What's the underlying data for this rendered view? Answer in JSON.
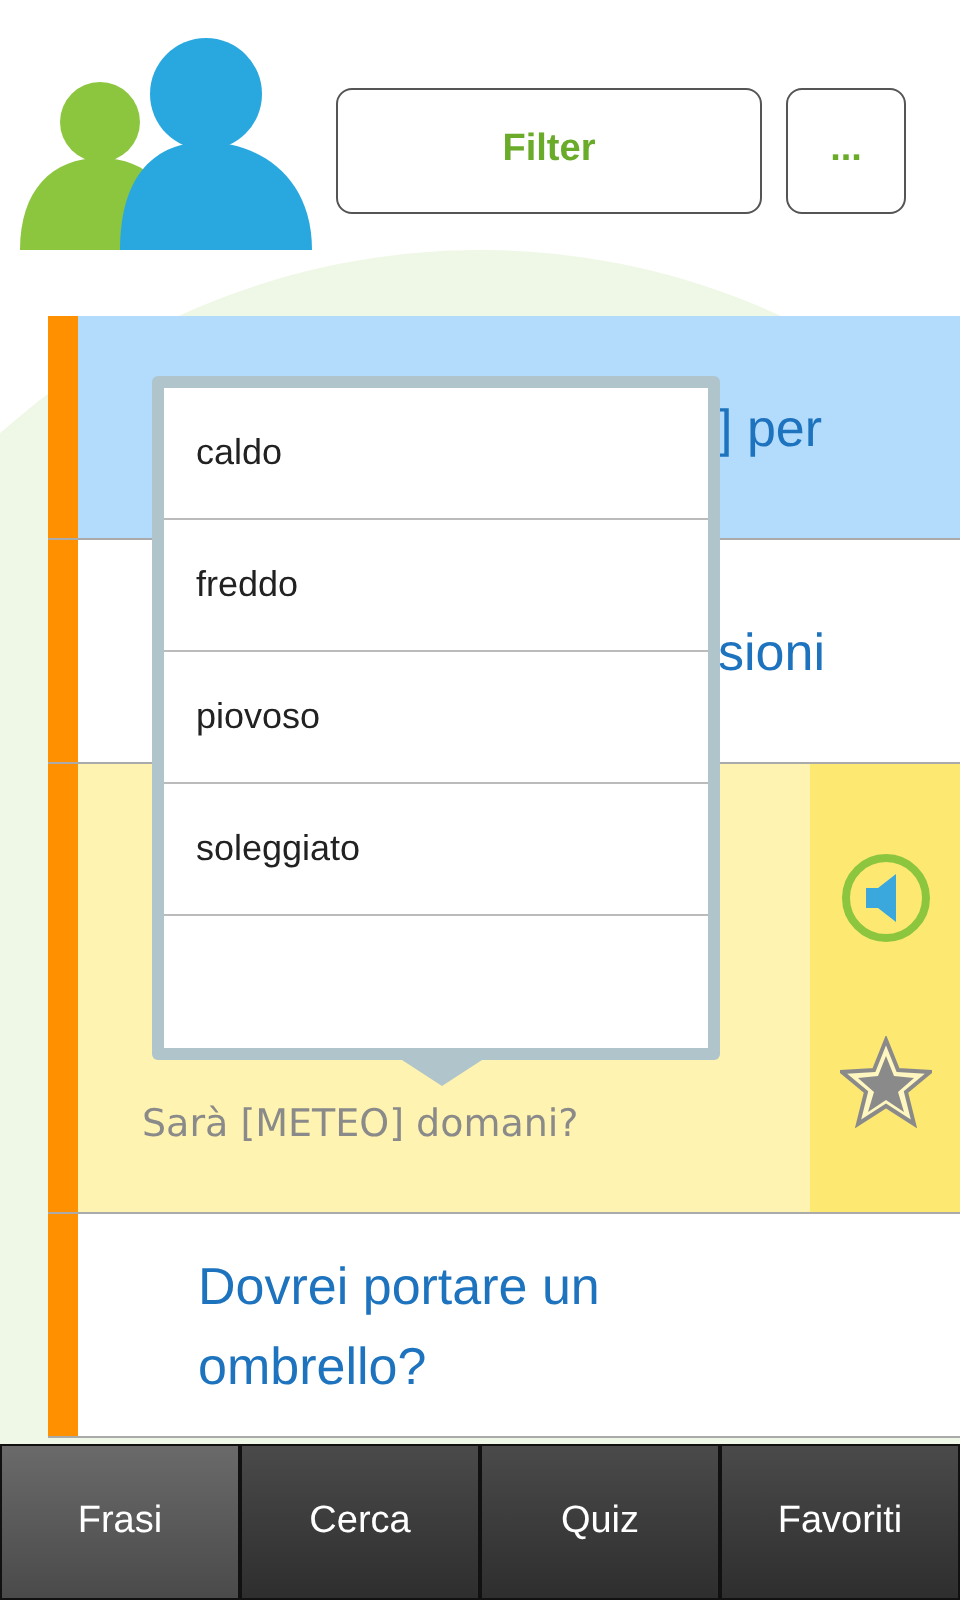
{
  "header": {
    "filter_button": "Filter",
    "more_button": "..."
  },
  "phrases": [
    {
      "text": "] per",
      "selected": true,
      "expanded": false
    },
    {
      "text": "sioni",
      "selected": false,
      "expanded": false
    },
    {
      "translation": "Sarà [METEO] domani?",
      "selected": false,
      "expanded": true
    },
    {
      "text": "Dovrei portare un ombrello?",
      "selected": false,
      "expanded": false
    }
  ],
  "dropdown": {
    "options": [
      {
        "label": "caldo",
        "selected": false
      },
      {
        "label": "freddo",
        "selected": false
      },
      {
        "label": "piovoso",
        "selected": false
      },
      {
        "label": "soleggiato",
        "selected": false
      }
    ]
  },
  "tabs": [
    {
      "label": "Frasi",
      "selected": true
    },
    {
      "label": "Cerca",
      "selected": false
    },
    {
      "label": "Quiz",
      "selected": false
    },
    {
      "label": "Favoriti",
      "selected": false
    }
  ]
}
